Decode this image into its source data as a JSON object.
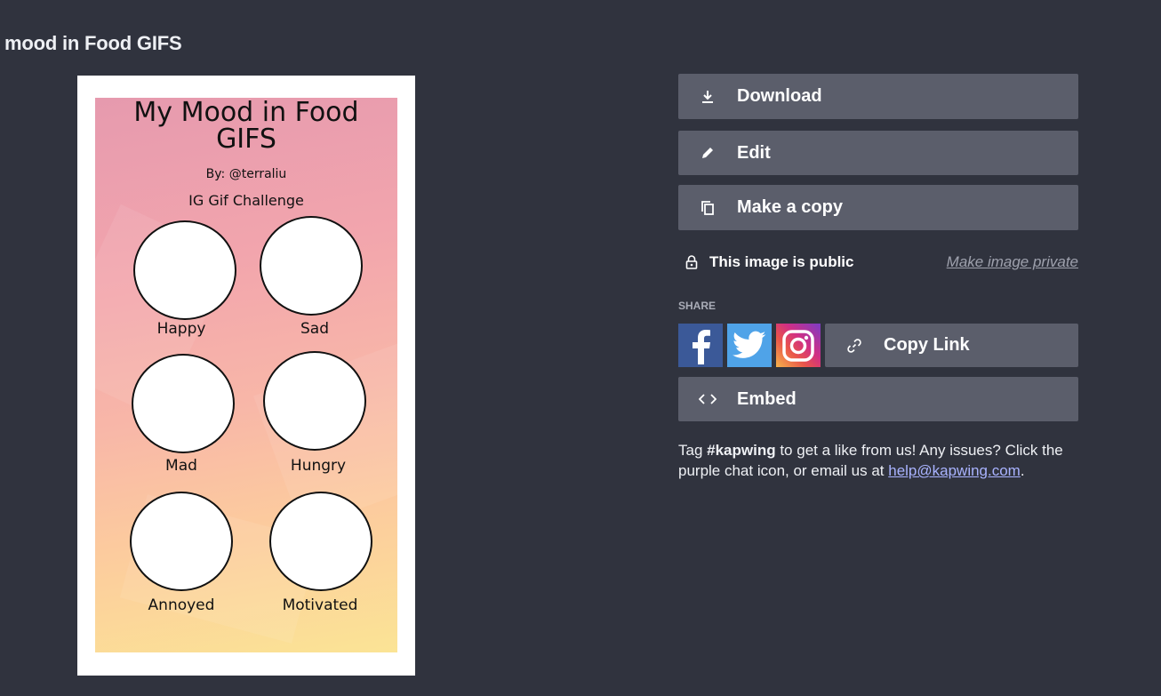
{
  "page": {
    "title": "mood in Food GIFS"
  },
  "preview": {
    "title": "My Mood in Food GIFS",
    "title_line1": "My Mood in Food",
    "title_line2": "GIFS",
    "byline": "By: @terraliu",
    "challenge": "IG Gif Challenge",
    "moods": [
      "Happy",
      "Sad",
      "Mad",
      "Hungry",
      "Annoyed",
      "Motivated"
    ]
  },
  "actions": {
    "download": "Download",
    "edit": "Edit",
    "make_copy": "Make a copy"
  },
  "visibility": {
    "status": "This image is public",
    "toggle_link": "Make image private"
  },
  "share": {
    "heading": "SHARE",
    "copy_link": "Copy Link",
    "embed": "Embed"
  },
  "footer": {
    "tag_prefix": "Tag ",
    "hashtag": "#kapwing",
    "tag_suffix": " to get a like from us! Any issues? Click the purple chat icon, or email us at ",
    "email": "help@kapwing.com",
    "end": "."
  },
  "colors": {
    "background": "#30333e",
    "button": "#5b5e6b",
    "facebook": "#3b5998",
    "twitter": "#4fa3e8",
    "link": "#a9b3ff"
  }
}
